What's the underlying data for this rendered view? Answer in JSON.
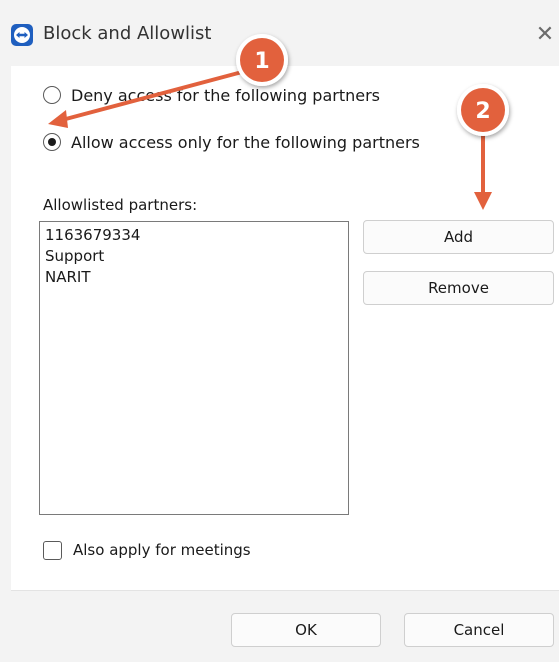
{
  "window": {
    "title": "Block and Allowlist",
    "close_symbol": "✕"
  },
  "options": {
    "deny_label": "Deny access for the following partners",
    "allow_label": "Allow access only for the following partners",
    "selected": "allow"
  },
  "list": {
    "label": "Allowlisted partners:",
    "items": [
      "1163679334",
      "Support",
      "NARIT"
    ]
  },
  "buttons": {
    "add": "Add",
    "remove": "Remove",
    "ok": "OK",
    "cancel": "Cancel"
  },
  "meetings": {
    "label": "Also apply for meetings",
    "checked": false
  },
  "annotations": {
    "marker_1": "1",
    "marker_2": "2",
    "color": "#e2613d"
  },
  "icons": {
    "app": "teamviewer-icon"
  }
}
